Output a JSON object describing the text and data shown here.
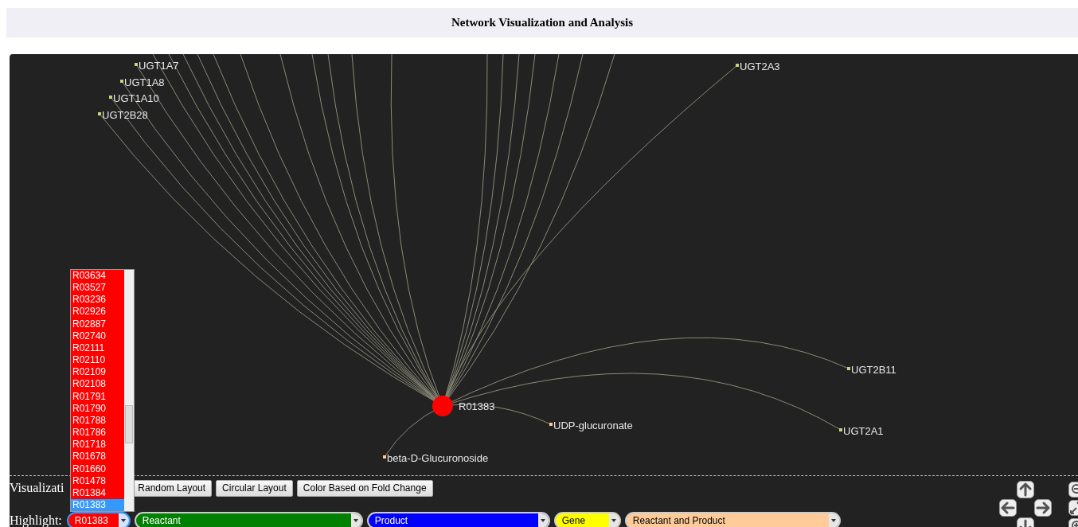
{
  "title": "Network Visualization and Analysis",
  "network": {
    "center": {
      "label": "R01383",
      "color": "#ff0000"
    },
    "nodes": [
      {
        "label": "UGT1A7",
        "color": "#c8d27a"
      },
      {
        "label": "UGT1A8",
        "color": "#c8d27a"
      },
      {
        "label": "UGT1A10",
        "color": "#c8d27a"
      },
      {
        "label": "UGT2B28",
        "color": "#c8d27a"
      },
      {
        "label": "UGT2A3",
        "color": "#c8d27a"
      },
      {
        "label": "UGT2B11",
        "color": "#c8d27a"
      },
      {
        "label": "UGT2A1",
        "color": "#c8d27a"
      },
      {
        "label": "UDP-glucuronate",
        "color": "#ffc890"
      },
      {
        "label": "beta-D-Glucuronoside",
        "color": "#ffc890"
      }
    ]
  },
  "visualization": {
    "label": "Visualizati",
    "buttons": [
      "Random Layout",
      "Circular Layout",
      "Color Based on Fold Change"
    ]
  },
  "highlight": {
    "label": "Highlight:",
    "selects": [
      {
        "value": "R01383",
        "color": "#ff0000",
        "expanded": true
      },
      {
        "value": "Reactant",
        "color": "#008000",
        "expanded": false
      },
      {
        "value": "Product",
        "color": "#0000ff",
        "expanded": false
      },
      {
        "value": "Gene",
        "color": "#ffff00",
        "expanded": false
      },
      {
        "value": "Reactant and Product",
        "color": "#ffcc99",
        "expanded": false
      }
    ]
  },
  "dropdown_options": [
    {
      "label": "R03634",
      "selected": false
    },
    {
      "label": "R03527",
      "selected": false
    },
    {
      "label": "R03236",
      "selected": false
    },
    {
      "label": "R02926",
      "selected": false
    },
    {
      "label": "R02887",
      "selected": false
    },
    {
      "label": "R02740",
      "selected": false
    },
    {
      "label": "R02111",
      "selected": false
    },
    {
      "label": "R02110",
      "selected": false
    },
    {
      "label": "R02109",
      "selected": false
    },
    {
      "label": "R02108",
      "selected": false
    },
    {
      "label": "R01791",
      "selected": false
    },
    {
      "label": "R01790",
      "selected": false
    },
    {
      "label": "R01788",
      "selected": false
    },
    {
      "label": "R01786",
      "selected": false
    },
    {
      "label": "R01718",
      "selected": false
    },
    {
      "label": "R01678",
      "selected": false
    },
    {
      "label": "R01660",
      "selected": false
    },
    {
      "label": "R01478",
      "selected": false
    },
    {
      "label": "R01384",
      "selected": false
    },
    {
      "label": "R01383",
      "selected": true
    }
  ]
}
